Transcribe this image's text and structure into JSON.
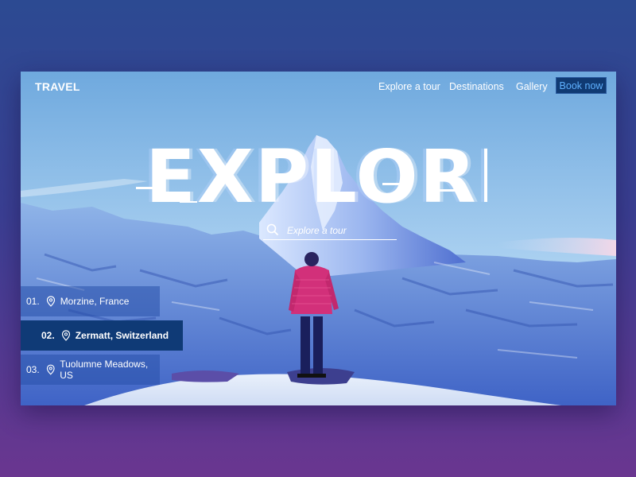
{
  "nav": {
    "logo": "TRAVEL",
    "links": [
      "Explore a tour",
      "Destinations",
      "Gallery"
    ],
    "cta": "Book now"
  },
  "hero": {
    "headline": "EXPLORE",
    "search_placeholder": "Explore a tour"
  },
  "locations": [
    {
      "num": "01.",
      "name": "Morzine, France",
      "active": false
    },
    {
      "num": "02.",
      "name": "Zermatt, Switzerland",
      "active": true
    },
    {
      "num": "03.",
      "name": "Tuolumne Meadows, US",
      "active": false
    }
  ],
  "colors": {
    "accent": "#103a73",
    "accent_text": "#5fb1ff",
    "jacket": "#d2307a"
  }
}
